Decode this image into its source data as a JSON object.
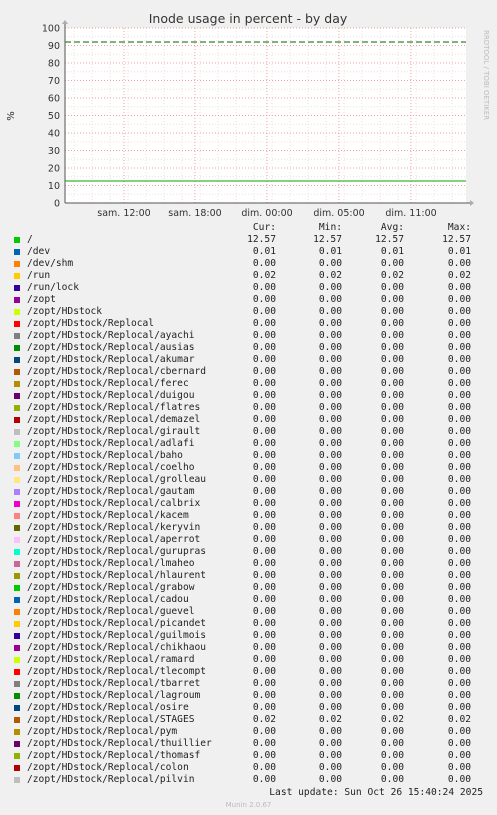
{
  "chart_data": {
    "type": "line",
    "title": "Inode usage in percent - by day",
    "ylabel": "%",
    "ylim": [
      0,
      100
    ],
    "yticks": [
      "0",
      "10",
      "20",
      "30",
      "40",
      "50",
      "60",
      "70",
      "80",
      "90",
      "100"
    ],
    "xticks": [
      "sam. 12:00",
      "sam. 18:00",
      "dim. 00:00",
      "dim. 05:00",
      "dim. 11:00"
    ],
    "warning_level": 92,
    "series_line": {
      "value": 12.57,
      "color": "#00aa00"
    },
    "warning_color": "#006600",
    "grid": true
  },
  "side_label": "RRDTOOL / TOBI OETIKER",
  "legend": {
    "headers": {
      "cur": "Cur:",
      "min": "Min:",
      "avg": "Avg:",
      "max": "Max:"
    },
    "rows": [
      {
        "name": "/",
        "color": "#00cc00",
        "cur": "12.57",
        "min": "12.57",
        "avg": "12.57",
        "max": "12.57"
      },
      {
        "name": "/dev",
        "color": "#0066b3",
        "cur": "0.01",
        "min": "0.01",
        "avg": "0.01",
        "max": "0.01"
      },
      {
        "name": "/dev/shm",
        "color": "#ff8000",
        "cur": "0.00",
        "min": "0.00",
        "avg": "0.00",
        "max": "0.00"
      },
      {
        "name": "/run",
        "color": "#ffcc00",
        "cur": "0.02",
        "min": "0.02",
        "avg": "0.02",
        "max": "0.02"
      },
      {
        "name": "/run/lock",
        "color": "#330099",
        "cur": "0.00",
        "min": "0.00",
        "avg": "0.00",
        "max": "0.00"
      },
      {
        "name": "/zopt",
        "color": "#990099",
        "cur": "0.00",
        "min": "0.00",
        "avg": "0.00",
        "max": "0.00"
      },
      {
        "name": "/zopt/HDstock",
        "color": "#ccff00",
        "cur": "0.00",
        "min": "0.00",
        "avg": "0.00",
        "max": "0.00"
      },
      {
        "name": "/zopt/HDstock/Replocal",
        "color": "#ff0000",
        "cur": "0.00",
        "min": "0.00",
        "avg": "0.00",
        "max": "0.00"
      },
      {
        "name": "/zopt/HDstock/Replocal/ayachi",
        "color": "#808080",
        "cur": "0.00",
        "min": "0.00",
        "avg": "0.00",
        "max": "0.00"
      },
      {
        "name": "/zopt/HDstock/Replocal/ausias",
        "color": "#008f00",
        "cur": "0.00",
        "min": "0.00",
        "avg": "0.00",
        "max": "0.00"
      },
      {
        "name": "/zopt/HDstock/Replocal/akumar",
        "color": "#00487d",
        "cur": "0.00",
        "min": "0.00",
        "avg": "0.00",
        "max": "0.00"
      },
      {
        "name": "/zopt/HDstock/Replocal/cbernard",
        "color": "#b35a00",
        "cur": "0.00",
        "min": "0.00",
        "avg": "0.00",
        "max": "0.00"
      },
      {
        "name": "/zopt/HDstock/Replocal/ferec",
        "color": "#b38f00",
        "cur": "0.00",
        "min": "0.00",
        "avg": "0.00",
        "max": "0.00"
      },
      {
        "name": "/zopt/HDstock/Replocal/duigou",
        "color": "#6b006b",
        "cur": "0.00",
        "min": "0.00",
        "avg": "0.00",
        "max": "0.00"
      },
      {
        "name": "/zopt/HDstock/Replocal/flatres",
        "color": "#8fb300",
        "cur": "0.00",
        "min": "0.00",
        "avg": "0.00",
        "max": "0.00"
      },
      {
        "name": "/zopt/HDstock/Replocal/demazel",
        "color": "#b30000",
        "cur": "0.00",
        "min": "0.00",
        "avg": "0.00",
        "max": "0.00"
      },
      {
        "name": "/zopt/HDstock/Replocal/girault",
        "color": "#bebebe",
        "cur": "0.00",
        "min": "0.00",
        "avg": "0.00",
        "max": "0.00"
      },
      {
        "name": "/zopt/HDstock/Replocal/adlafi",
        "color": "#80ff80",
        "cur": "0.00",
        "min": "0.00",
        "avg": "0.00",
        "max": "0.00"
      },
      {
        "name": "/zopt/HDstock/Replocal/baho",
        "color": "#80c9ff",
        "cur": "0.00",
        "min": "0.00",
        "avg": "0.00",
        "max": "0.00"
      },
      {
        "name": "/zopt/HDstock/Replocal/coelho",
        "color": "#ffc080",
        "cur": "0.00",
        "min": "0.00",
        "avg": "0.00",
        "max": "0.00"
      },
      {
        "name": "/zopt/HDstock/Replocal/grolleau",
        "color": "#ffe680",
        "cur": "0.00",
        "min": "0.00",
        "avg": "0.00",
        "max": "0.00"
      },
      {
        "name": "/zopt/HDstock/Replocal/gautam",
        "color": "#aa80ff",
        "cur": "0.00",
        "min": "0.00",
        "avg": "0.00",
        "max": "0.00"
      },
      {
        "name": "/zopt/HDstock/Replocal/calbrix",
        "color": "#ee00cc",
        "cur": "0.00",
        "min": "0.00",
        "avg": "0.00",
        "max": "0.00"
      },
      {
        "name": "/zopt/HDstock/Replocal/kacem",
        "color": "#ff8080",
        "cur": "0.00",
        "min": "0.00",
        "avg": "0.00",
        "max": "0.00"
      },
      {
        "name": "/zopt/HDstock/Replocal/keryvin",
        "color": "#666600",
        "cur": "0.00",
        "min": "0.00",
        "avg": "0.00",
        "max": "0.00"
      },
      {
        "name": "/zopt/HDstock/Replocal/aperrot",
        "color": "#ffbfff",
        "cur": "0.00",
        "min": "0.00",
        "avg": "0.00",
        "max": "0.00"
      },
      {
        "name": "/zopt/HDstock/Replocal/gurupras",
        "color": "#00ffcc",
        "cur": "0.00",
        "min": "0.00",
        "avg": "0.00",
        "max": "0.00"
      },
      {
        "name": "/zopt/HDstock/Replocal/lmaheo",
        "color": "#cc6699",
        "cur": "0.00",
        "min": "0.00",
        "avg": "0.00",
        "max": "0.00"
      },
      {
        "name": "/zopt/HDstock/Replocal/hlaurent",
        "color": "#999900",
        "cur": "0.00",
        "min": "0.00",
        "avg": "0.00",
        "max": "0.00"
      },
      {
        "name": "/zopt/HDstock/Replocal/grabow",
        "color": "#00cc00",
        "cur": "0.00",
        "min": "0.00",
        "avg": "0.00",
        "max": "0.00"
      },
      {
        "name": "/zopt/HDstock/Replocal/cadou",
        "color": "#0066b3",
        "cur": "0.00",
        "min": "0.00",
        "avg": "0.00",
        "max": "0.00"
      },
      {
        "name": "/zopt/HDstock/Replocal/guevel",
        "color": "#ff8000",
        "cur": "0.00",
        "min": "0.00",
        "avg": "0.00",
        "max": "0.00"
      },
      {
        "name": "/zopt/HDstock/Replocal/picandet",
        "color": "#ffcc00",
        "cur": "0.00",
        "min": "0.00",
        "avg": "0.00",
        "max": "0.00"
      },
      {
        "name": "/zopt/HDstock/Replocal/guilmois",
        "color": "#330099",
        "cur": "0.00",
        "min": "0.00",
        "avg": "0.00",
        "max": "0.00"
      },
      {
        "name": "/zopt/HDstock/Replocal/chikhaou",
        "color": "#990099",
        "cur": "0.00",
        "min": "0.00",
        "avg": "0.00",
        "max": "0.00"
      },
      {
        "name": "/zopt/HDstock/Replocal/ramard",
        "color": "#ccff00",
        "cur": "0.00",
        "min": "0.00",
        "avg": "0.00",
        "max": "0.00"
      },
      {
        "name": "/zopt/HDstock/Replocal/tlecompt",
        "color": "#ff0000",
        "cur": "0.00",
        "min": "0.00",
        "avg": "0.00",
        "max": "0.00"
      },
      {
        "name": "/zopt/HDstock/Replocal/tbarret",
        "color": "#808080",
        "cur": "0.00",
        "min": "0.00",
        "avg": "0.00",
        "max": "0.00"
      },
      {
        "name": "/zopt/HDstock/Replocal/lagroum",
        "color": "#008f00",
        "cur": "0.00",
        "min": "0.00",
        "avg": "0.00",
        "max": "0.00"
      },
      {
        "name": "/zopt/HDstock/Replocal/osire",
        "color": "#00487d",
        "cur": "0.00",
        "min": "0.00",
        "avg": "0.00",
        "max": "0.00"
      },
      {
        "name": "/zopt/HDstock/Replocal/STAGES",
        "color": "#b35a00",
        "cur": "0.02",
        "min": "0.02",
        "avg": "0.02",
        "max": "0.02"
      },
      {
        "name": "/zopt/HDstock/Replocal/pym",
        "color": "#b38f00",
        "cur": "0.00",
        "min": "0.00",
        "avg": "0.00",
        "max": "0.00"
      },
      {
        "name": "/zopt/HDstock/Replocal/thuillier",
        "color": "#6b006b",
        "cur": "0.00",
        "min": "0.00",
        "avg": "0.00",
        "max": "0.00"
      },
      {
        "name": "/zopt/HDstock/Replocal/thomasf",
        "color": "#8fb300",
        "cur": "0.00",
        "min": "0.00",
        "avg": "0.00",
        "max": "0.00"
      },
      {
        "name": "/zopt/HDstock/Replocal/colon",
        "color": "#b30000",
        "cur": "0.00",
        "min": "0.00",
        "avg": "0.00",
        "max": "0.00"
      },
      {
        "name": "/zopt/HDstock/Replocal/pilvin",
        "color": "#bebebe",
        "cur": "0.00",
        "min": "0.00",
        "avg": "0.00",
        "max": "0.00"
      }
    ]
  },
  "footer": {
    "last_update": "Last update: Sun Oct 26 15:40:24 2025",
    "munin": "Munin 2.0.67"
  }
}
